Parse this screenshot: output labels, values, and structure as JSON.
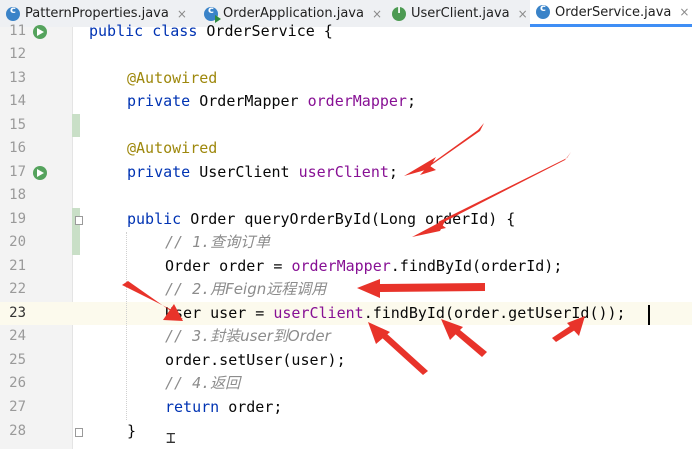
{
  "tabs": [
    {
      "label": "PatternProperties.java",
      "icon": "class-icon",
      "active": false
    },
    {
      "label": "OrderApplication.java",
      "icon": "class-run-icon",
      "active": false
    },
    {
      "label": "UserClient.java",
      "icon": "interface-icon",
      "active": false
    },
    {
      "label": "OrderService.java",
      "icon": "class-icon",
      "active": true
    }
  ],
  "close_glyph": "×",
  "lines": [
    {
      "num": "11"
    },
    {
      "num": "12"
    },
    {
      "num": "13"
    },
    {
      "num": "14"
    },
    {
      "num": "15"
    },
    {
      "num": "16"
    },
    {
      "num": "17"
    },
    {
      "num": "18"
    },
    {
      "num": "19"
    },
    {
      "num": "20"
    },
    {
      "num": "21"
    },
    {
      "num": "22"
    },
    {
      "num": "23"
    },
    {
      "num": "24"
    },
    {
      "num": "25"
    },
    {
      "num": "26"
    },
    {
      "num": "27"
    },
    {
      "num": "28"
    }
  ],
  "code": {
    "l11": {
      "kw1": "public class ",
      "name": "OrderService {"
    },
    "l13": {
      "ann": "@Autowired"
    },
    "l14": {
      "kw": "private ",
      "type": "OrderMapper ",
      "field": "orderMapper",
      "end": ";"
    },
    "l16": {
      "ann": "@Autowired"
    },
    "l17": {
      "kw": "private ",
      "type": "UserClient ",
      "field": "userClient",
      "end": ";"
    },
    "l19": {
      "kw": "public ",
      "rest": "Order queryOrderById(Long orderId) {"
    },
    "l20": {
      "prefix": "// 1.",
      "cjk": "查询订单"
    },
    "l21": {
      "pre": "Order order = ",
      "field": "orderMapper",
      "post": ".findById(orderId);"
    },
    "l22": {
      "prefix": "// 2.",
      "cjk1": "用",
      "latin": "Feign",
      "cjk2": "远程调用"
    },
    "l23": {
      "pre": "User user = ",
      "field": "userClient",
      "post": ".findById(order.getUserId());"
    },
    "l24": {
      "prefix": "// 3.",
      "cjk1": "封装",
      "latin": "user",
      "cjk2": "到",
      "latin2": "Order"
    },
    "l25": {
      "text": "order.setUser(user);"
    },
    "l26": {
      "prefix": "// 4.",
      "cjk": "返回"
    },
    "l27": {
      "kw": "return ",
      "rest": "order;"
    },
    "l28": {
      "text": "}"
    }
  },
  "colors": {
    "keyword": "#0033b3",
    "annotation": "#9e880d",
    "field": "#871094",
    "comment": "#8c8c8c",
    "arrow": "#e8332a",
    "active_tab_underline": "#3f8ef5"
  },
  "caret_line": "23"
}
